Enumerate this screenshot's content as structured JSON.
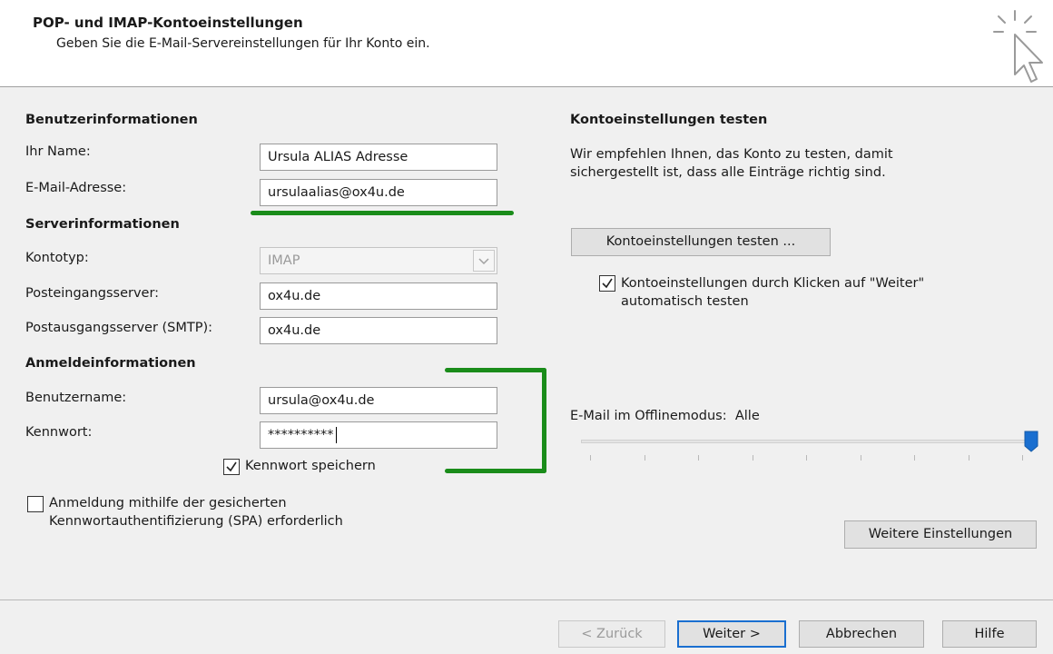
{
  "header": {
    "title": "POP- und IMAP-Kontoeinstellungen",
    "subtitle": "Geben Sie die E-Mail-Servereinstellungen für Ihr Konto ein."
  },
  "user_info": {
    "heading": "Benutzerinformationen",
    "name_label": "Ihr Name:",
    "name_value": "Ursula ALIAS Adresse",
    "email_label": "E-Mail-Adresse:",
    "email_value": "ursulaalias@ox4u.de"
  },
  "server_info": {
    "heading": "Serverinformationen",
    "account_type_label": "Kontotyp:",
    "account_type_value": "IMAP",
    "incoming_label": "Posteingangsserver:",
    "incoming_value": "ox4u.de",
    "outgoing_label": "Postausgangsserver (SMTP):",
    "outgoing_value": "ox4u.de"
  },
  "login_info": {
    "heading": "Anmeldeinformationen",
    "username_label": "Benutzername:",
    "username_value": "ursula@ox4u.de",
    "password_label": "Kennwort:",
    "password_value": "**********",
    "save_password_label": "Kennwort speichern",
    "save_password_checked": true,
    "spa_label_line1": "Anmeldung mithilfe der gesicherten",
    "spa_label_line2": "Kennwortauthentifizierung (SPA) erforderlich",
    "spa_checked": false
  },
  "test_settings": {
    "heading": "Kontoeinstellungen testen",
    "description_line1": "Wir empfehlen Ihnen, das Konto zu testen, damit",
    "description_line2": "sichergestellt ist, dass alle Einträge richtig sind.",
    "test_button": "Kontoeinstellungen testen ...",
    "auto_test_label_line1": "Kontoeinstellungen durch Klicken auf \"Weiter\"",
    "auto_test_label_line2": "automatisch testen",
    "auto_test_checked": true
  },
  "offline": {
    "label": "E-Mail im Offlinemodus:",
    "value": "Alle",
    "slider_fraction": 1.0
  },
  "more_settings_button": "Weitere Einstellungen",
  "footer": {
    "back": "< Zurück",
    "next": "Weiter >",
    "cancel": "Abbrechen",
    "help": "Hilfe"
  },
  "colors": {
    "highlight_green": "#1a8c1a",
    "primary_border": "#1a6fd0",
    "slider_thumb": "#1a6fd0"
  }
}
